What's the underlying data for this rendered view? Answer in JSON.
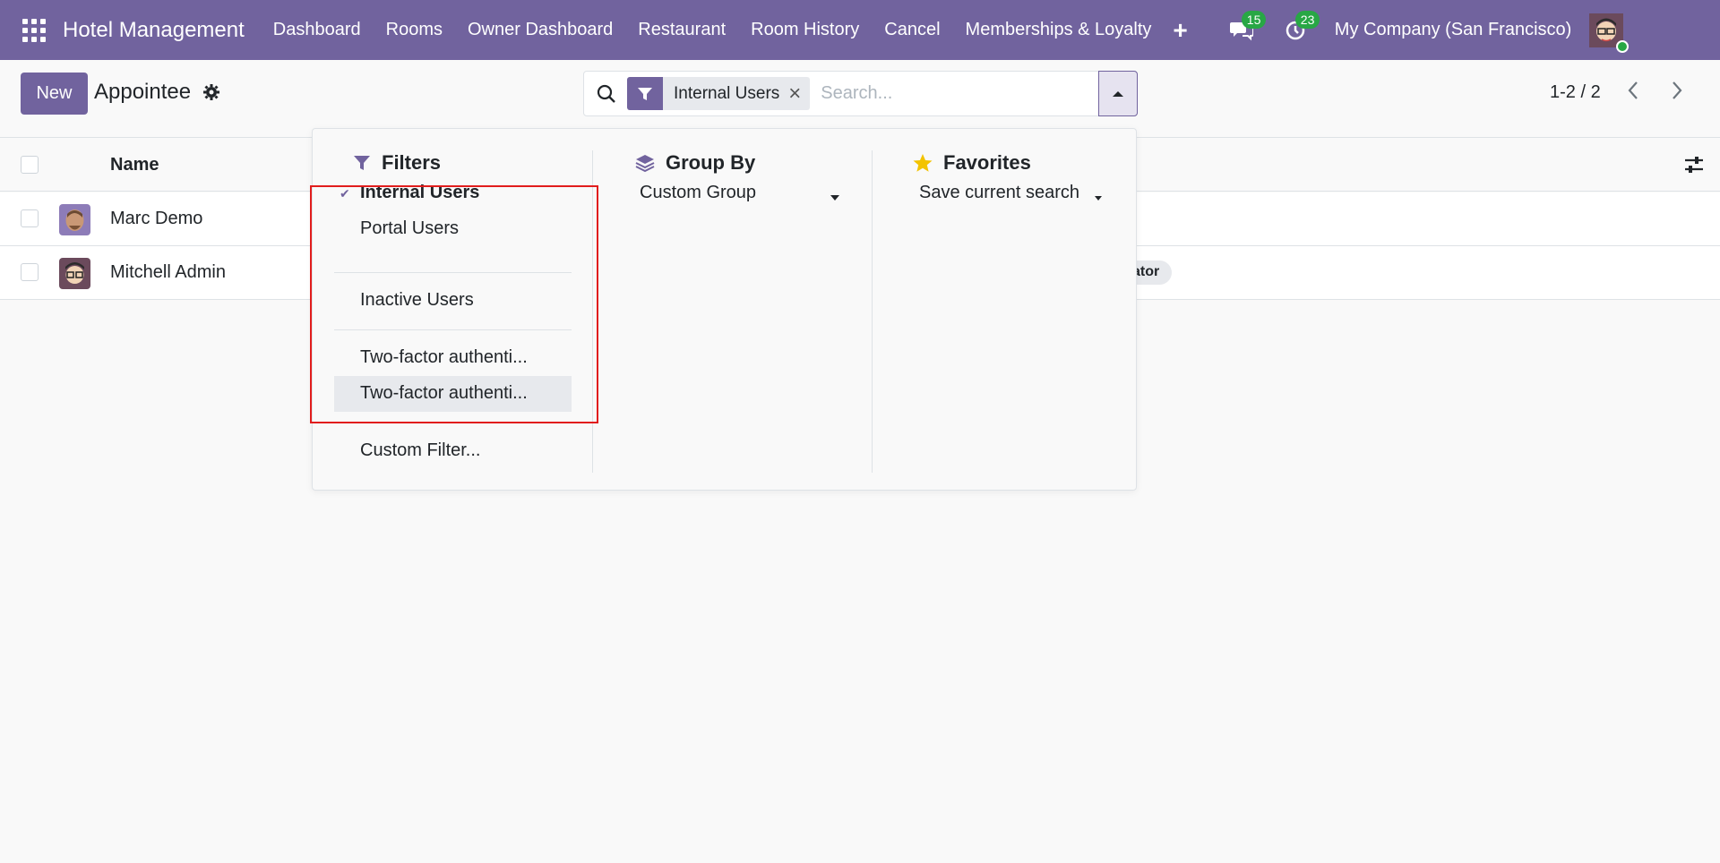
{
  "navbar": {
    "app_name": "Hotel Management",
    "menu": [
      "Dashboard",
      "Rooms",
      "Owner Dashboard",
      "Restaurant",
      "Room History",
      "Cancel",
      "Memberships & Loyalty"
    ],
    "messages_count": "15",
    "activities_count": "23",
    "company": "My Company (San Francisco)"
  },
  "control_panel": {
    "new_label": "New",
    "title": "Appointee",
    "search": {
      "facet_label": "Internal Users",
      "placeholder": "Search..."
    },
    "pager": "1-2 / 2"
  },
  "list": {
    "columns": [
      "Name"
    ],
    "rows": [
      {
        "name": "Marc Demo",
        "tag": ""
      },
      {
        "name": "Mitchell Admin",
        "tag": "ator"
      }
    ]
  },
  "dropdown": {
    "filters": {
      "heading": "Filters",
      "items": [
        "Internal Users",
        "Portal Users",
        "Inactive Users",
        "Two-factor authenti...",
        "Two-factor authenti...",
        "Custom Filter..."
      ],
      "checked": "Internal Users"
    },
    "group_by": {
      "heading": "Group By",
      "custom_group_label": "Custom Group"
    },
    "favorites": {
      "heading": "Favorites",
      "save_label": "Save current search"
    }
  },
  "colors": {
    "brand": "#71639e",
    "badge": "#28a745",
    "highlight": "#e11d1d",
    "favorite_star": "#f3c300"
  },
  "icons": [
    "apps-icon",
    "plus-icon",
    "chat-icon",
    "activity-clock-icon",
    "gear-icon",
    "search-icon",
    "filter-icon",
    "close-icon",
    "caret-up-icon",
    "chevron-left-icon",
    "chevron-right-icon",
    "sliders-icon",
    "layers-icon",
    "star-icon",
    "check-icon",
    "caret-down-icon"
  ]
}
